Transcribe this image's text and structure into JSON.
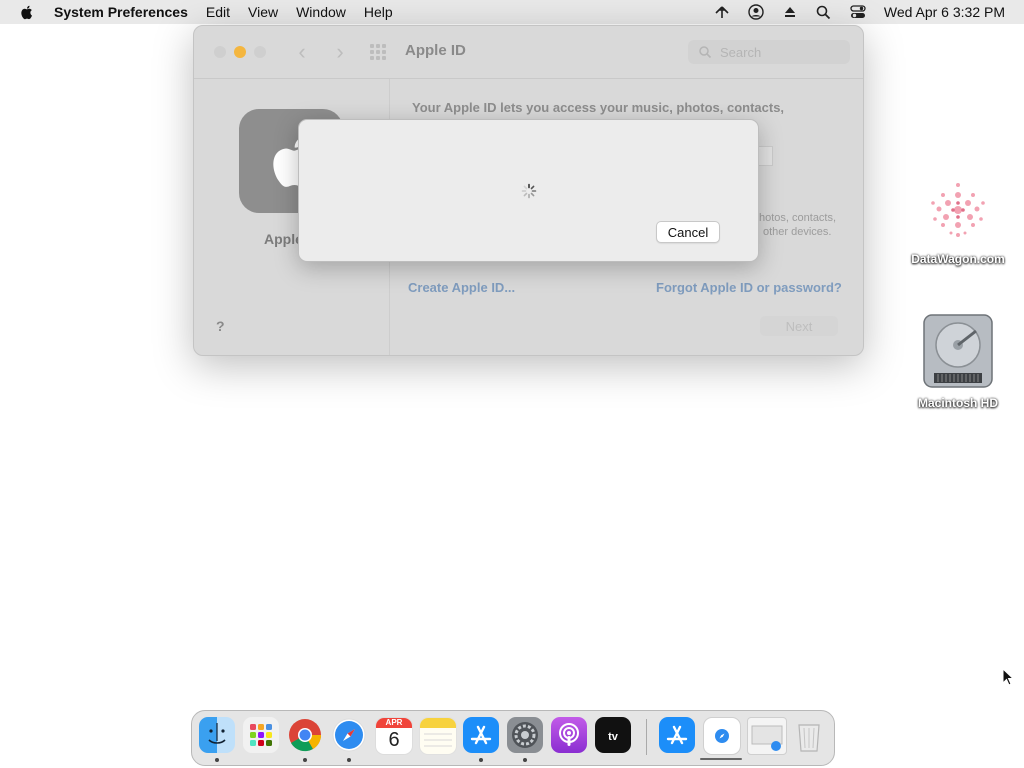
{
  "menubar": {
    "app_name": "System Preferences",
    "items": [
      "Edit",
      "View",
      "Window",
      "Help"
    ],
    "clock": "Wed Apr 6  3:32 PM"
  },
  "window": {
    "title": "Apple ID",
    "search_placeholder": "Search",
    "sidebar_label": "Apple",
    "intro_text": "Your Apple ID lets you access your music, photos, contacts,",
    "side_text_1": "hotos, contacts,",
    "side_text_2": "other devices.",
    "create_link": "Create Apple ID...",
    "forgot_link": "Forgot Apple ID or password?",
    "next_label": "Next",
    "help_label": "?"
  },
  "sheet": {
    "cancel_label": "Cancel",
    "state": "loading"
  },
  "desktop": {
    "icons": [
      "DataWagon.com",
      "Macintosh HD"
    ]
  },
  "dock": {
    "calendar_month": "APR",
    "calendar_day": "6",
    "apps": [
      "Finder",
      "Launchpad",
      "Chrome",
      "Safari",
      "Calendar",
      "Notes",
      "App Store",
      "System Preferences",
      "Podcasts",
      "TV",
      "App Store (downloads)",
      "Document",
      "Preview",
      "Trash"
    ]
  },
  "colors": {
    "accent_link": "#7f9cbe",
    "minimize_light": "#f4b63f"
  }
}
